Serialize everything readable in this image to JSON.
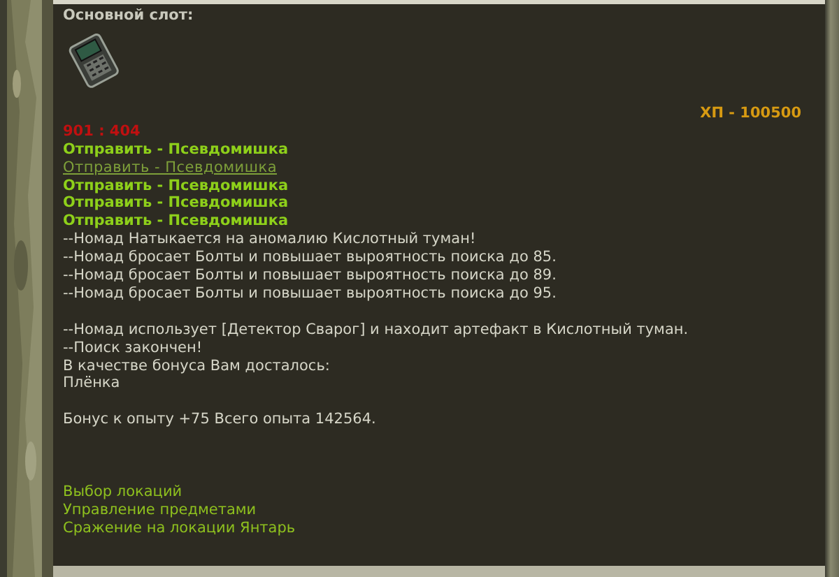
{
  "slot": {
    "title": "Основной слот:"
  },
  "player_hp": "ХП - 100500",
  "enemy_hp": "901 : 404",
  "actions": [
    {
      "label": "Отправить - Псевдомишка",
      "hovered": false
    },
    {
      "label": "Отправить - Псевдомишка",
      "hovered": true
    },
    {
      "label": "Отправить - Псевдомишка",
      "hovered": false
    },
    {
      "label": "Отправить - Псевдомишка",
      "hovered": false
    },
    {
      "label": "Отправить - Псевдомишка",
      "hovered": false
    }
  ],
  "log_blocks": [
    [
      "--Номад Натыкается на аномалию Кислотный туман!",
      "--Номад бросает Болты и повышает выроятность поиска до 85.",
      "--Номад бросает Болты и повышает выроятность поиска до 89.",
      "--Номад бросает Болты и повышает выроятность поиска до 95."
    ],
    [
      "--Номад использует [Детектор Сварог] и находит артефакт в Кислотный туман.",
      "--Поиск закончен!",
      "В качестве бонуса Вам досталось:",
      "Плёнка"
    ],
    [
      "Бонус к опыту +75 Всего опыта 142564."
    ]
  ],
  "menu": [
    "Выбор локаций",
    "Управление предметами",
    "Сражение на локации Янтарь"
  ]
}
